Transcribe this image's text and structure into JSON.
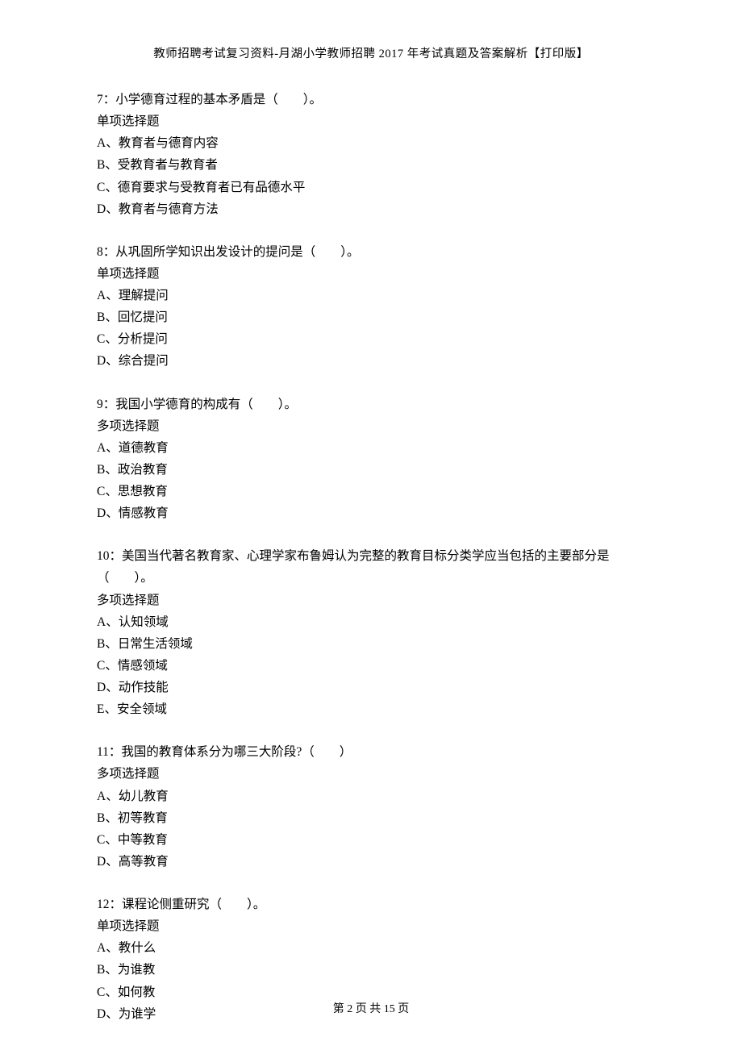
{
  "header": "教师招聘考试复习资料-月湖小学教师招聘 2017 年考试真题及答案解析【打印版】",
  "questions": [
    {
      "stem": "7：小学德育过程的基本矛盾是（　　）。",
      "type": "单项选择题",
      "options": [
        "A、教育者与德育内容",
        "B、受教育者与教育者",
        "C、德育要求与受教育者已有品德水平",
        "D、教育者与德育方法"
      ]
    },
    {
      "stem": "8：从巩固所学知识出发设计的提问是（　　）。",
      "type": "单项选择题",
      "options": [
        "A、理解提问",
        "B、回忆提问",
        "C、分析提问",
        "D、综合提问"
      ]
    },
    {
      "stem": "9：我国小学德育的构成有（　　）。",
      "type": "多项选择题",
      "options": [
        "A、道德教育",
        "B、政治教育",
        "C、思想教育",
        "D、情感教育"
      ]
    },
    {
      "stem": "10：美国当代著名教育家、心理学家布鲁姆认为完整的教育目标分类学应当包括的主要部分是（　　）。",
      "type": "多项选择题",
      "options": [
        "A、认知领域",
        "B、日常生活领域",
        "C、情感领域",
        "D、动作技能",
        "E、安全领域"
      ]
    },
    {
      "stem": "11：我国的教育体系分为哪三大阶段?（　　）",
      "type": "多项选择题",
      "options": [
        "A、幼儿教育",
        "B、初等教育",
        "C、中等教育",
        "D、高等教育"
      ]
    },
    {
      "stem": "12：课程论侧重研究（　　）。",
      "type": "单项选择题",
      "options": [
        "A、教什么",
        "B、为谁教",
        "C、如何教",
        "D、为谁学"
      ]
    }
  ],
  "footer": "第 2 页 共 15 页"
}
